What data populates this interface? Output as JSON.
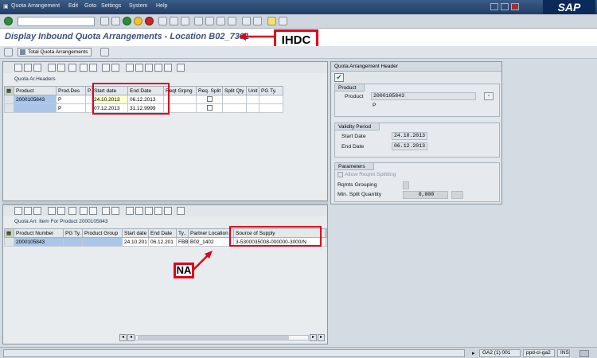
{
  "menu": {
    "items": [
      "Quota Arrangement",
      "Edit",
      "Goto",
      "Settings",
      "System",
      "Help"
    ],
    "logo_text": "SAP"
  },
  "title": {
    "text": "Display Inbound Quota Arrangements - Location B02_7301",
    "annotation": "IHDC"
  },
  "appbar": {
    "total_button": "Total Quota Arrangements"
  },
  "headers_grid": {
    "title": "Quota Ar.Headers",
    "columns": [
      "Product",
      "Prod.Des",
      "P",
      "Start date",
      "End Date",
      "Reqt Grpng",
      "Req. Split",
      "Split Qty",
      "Unit",
      "PG Ty."
    ],
    "rows": [
      {
        "product": "2000105843",
        "prod_des": "P",
        "p": "",
        "start": "24.10.2013",
        "end": "06.12.2013",
        "reqt": "",
        "split": "",
        "qty": "",
        "unit": "",
        "pg": ""
      },
      {
        "product": "",
        "prod_des": "P",
        "p": "",
        "start": "07.12.2013",
        "end": "31.12.9999",
        "reqt": "",
        "split": "",
        "qty": "",
        "unit": "",
        "pg": ""
      }
    ]
  },
  "items_grid": {
    "title": "Quota Arr. Item For Product 2000105843",
    "columns": [
      "Product Number",
      "PG Ty.",
      "Product Group",
      "Start date",
      "End Date",
      "Ty..",
      "Partner Location",
      "Source of Supply",
      "Pr"
    ],
    "rows": [
      {
        "product": "2000105843",
        "pg": "",
        "group": "",
        "start": "24.10.201",
        "end": "06.12.201",
        "ty": "FBB",
        "partner": "B02_1402",
        "source": "3-5300035008-000000-3000/N",
        "pr": ""
      }
    ],
    "annotation": "NA"
  },
  "right": {
    "header_title": "Quota Arrangement Header",
    "product_group": {
      "title": "Product",
      "label": "Product",
      "value": "2000105843",
      "desc": "P"
    },
    "validity_group": {
      "title": "Validity Period",
      "start_label": "Start Date",
      "start_value": "24.10.2013",
      "end_label": "End Date",
      "end_value": "06.12.2013"
    },
    "params_group": {
      "title": "Parameters",
      "allow_label": "Allow Reqmt Splitting",
      "rqmts_label": "Rqmts Grouping",
      "min_label": "Min. Split Quantity",
      "min_value": "0,000"
    }
  },
  "status": {
    "system": "GA2 (1) 001",
    "server": "ppd-ci-ga2",
    "mode": "INS"
  },
  "colors": {
    "accent_red": "#e0001b",
    "title_blue": "#3a4f80",
    "selection_blue": "#a9c6e8"
  }
}
